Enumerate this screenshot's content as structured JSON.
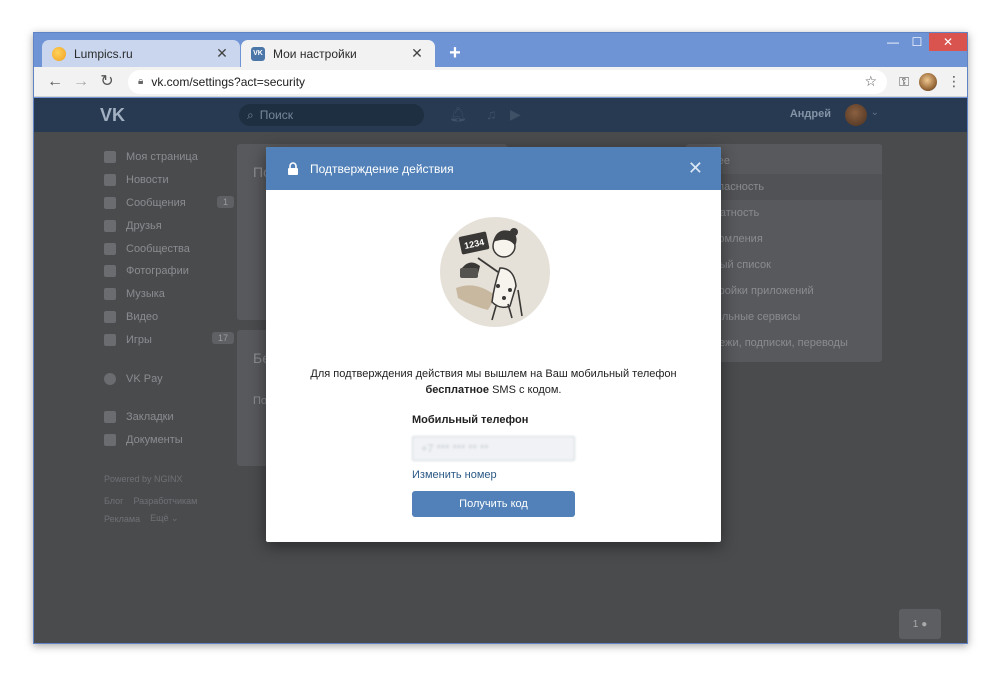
{
  "browser": {
    "tabs": [
      {
        "label": "Lumpics.ru",
        "close": "✕"
      },
      {
        "label": "Мои настройки",
        "close": "✕"
      }
    ],
    "new_tab": "+",
    "window_controls": {
      "minimize": "—",
      "maximize": "☐",
      "close": "✕"
    },
    "url": "vk.com/settings?act=security"
  },
  "vk": {
    "logo": "VK",
    "search_placeholder": "Поиск",
    "user_name": "Андрей",
    "left_menu": [
      {
        "label": "Моя страница"
      },
      {
        "label": "Новости"
      },
      {
        "label": "Сообщения",
        "count": "1"
      },
      {
        "label": "Друзья"
      },
      {
        "label": "Сообщества"
      },
      {
        "label": "Фотографии"
      },
      {
        "label": "Музыка"
      },
      {
        "label": "Видео"
      },
      {
        "label": "Игры",
        "count": "17"
      },
      {
        "label": "VK Pay"
      },
      {
        "label": "Закладки"
      },
      {
        "label": "Документы"
      }
    ],
    "powered": "Powered by NGINX",
    "footer_links": [
      "Блог",
      "Разработчикам",
      "Реклама",
      "Ещё ⌄"
    ],
    "card_titles": [
      "По",
      "Бе",
      "По"
    ],
    "settings_menu": [
      "Общее",
      "Безопасность",
      "Приватность",
      "Уведомления",
      "Чёрный список",
      "Настройки приложений",
      "Мобильные сервисы",
      "Платежи, подписки, переводы"
    ],
    "selected_settings_index": 1,
    "online_count": "1"
  },
  "modal": {
    "title": "Подтверждение действия",
    "close": "✕",
    "sign_number": "1234",
    "message_line1": "Для подтверждения действия мы вышлем на Ваш мобильный телефон",
    "message_bold": "бесплатное",
    "message_rest": " SMS с кодом.",
    "phone_label": "Мобильный телефон",
    "phone_value": "+7 *** *** ** **",
    "change_link": "Изменить номер",
    "submit": "Получить код"
  },
  "colors": {
    "vk_blue": "#5181b8",
    "vk_header": "#273a51",
    "overlay_bg": "#4a4b4d",
    "browser_frame": "#6f94d6"
  }
}
